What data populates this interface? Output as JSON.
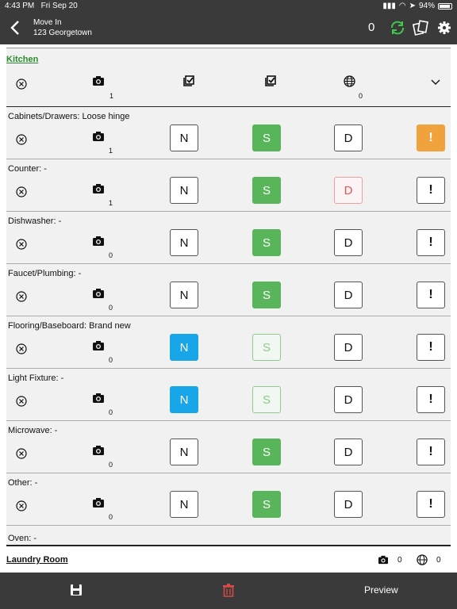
{
  "status_bar": {
    "time": "4:43 PM",
    "date": "Fri Sep 20",
    "battery": "94%"
  },
  "nav": {
    "title": "Move In",
    "subtitle": "123 Georgetown",
    "count": "0"
  },
  "section": {
    "title": "Kitchen",
    "photo_count": "1",
    "globe_count": "0"
  },
  "items": [
    {
      "label": "Cabinets/Drawers: Loose hinge",
      "photos": "1",
      "n": "N",
      "s": "S",
      "d": "D",
      "flag": "!"
    },
    {
      "label": "Counter:  -",
      "photos": "1",
      "n": "N",
      "s": "S",
      "d": "D",
      "flag": "!"
    },
    {
      "label": "Dishwasher:  -",
      "photos": "0",
      "n": "N",
      "s": "S",
      "d": "D",
      "flag": "!"
    },
    {
      "label": "Faucet/Plumbing:  -",
      "photos": "0",
      "n": "N",
      "s": "S",
      "d": "D",
      "flag": "!"
    },
    {
      "label": "Flooring/Baseboard: Brand new",
      "photos": "0",
      "n": "N",
      "s": "S",
      "d": "D",
      "flag": "!"
    },
    {
      "label": "Light Fixture:  -",
      "photos": "0",
      "n": "N",
      "s": "S",
      "d": "D",
      "flag": "!"
    },
    {
      "label": "Microwave:  -",
      "photos": "0",
      "n": "N",
      "s": "S",
      "d": "D",
      "flag": "!"
    },
    {
      "label": "Other:  -",
      "photos": "0",
      "n": "N",
      "s": "S",
      "d": "D",
      "flag": "!"
    }
  ],
  "oven_label": "Oven:  -",
  "laundry": {
    "title": "Laundry Room",
    "photo_count": "0",
    "globe_count": "0"
  },
  "bottom": {
    "preview": "Preview"
  },
  "colors": {
    "green": "#58b55a",
    "blue": "#19a6e8",
    "orange": "#f0a23c",
    "bar": "#3a3a3a"
  },
  "icons": [
    "back-chevron-icon",
    "sync-icon",
    "pages-icon",
    "gear-icon",
    "clear-circle-icon",
    "camera-icon",
    "checkbox-icon",
    "globe-icon",
    "chevron-down-icon",
    "save-icon",
    "trash-icon"
  ]
}
